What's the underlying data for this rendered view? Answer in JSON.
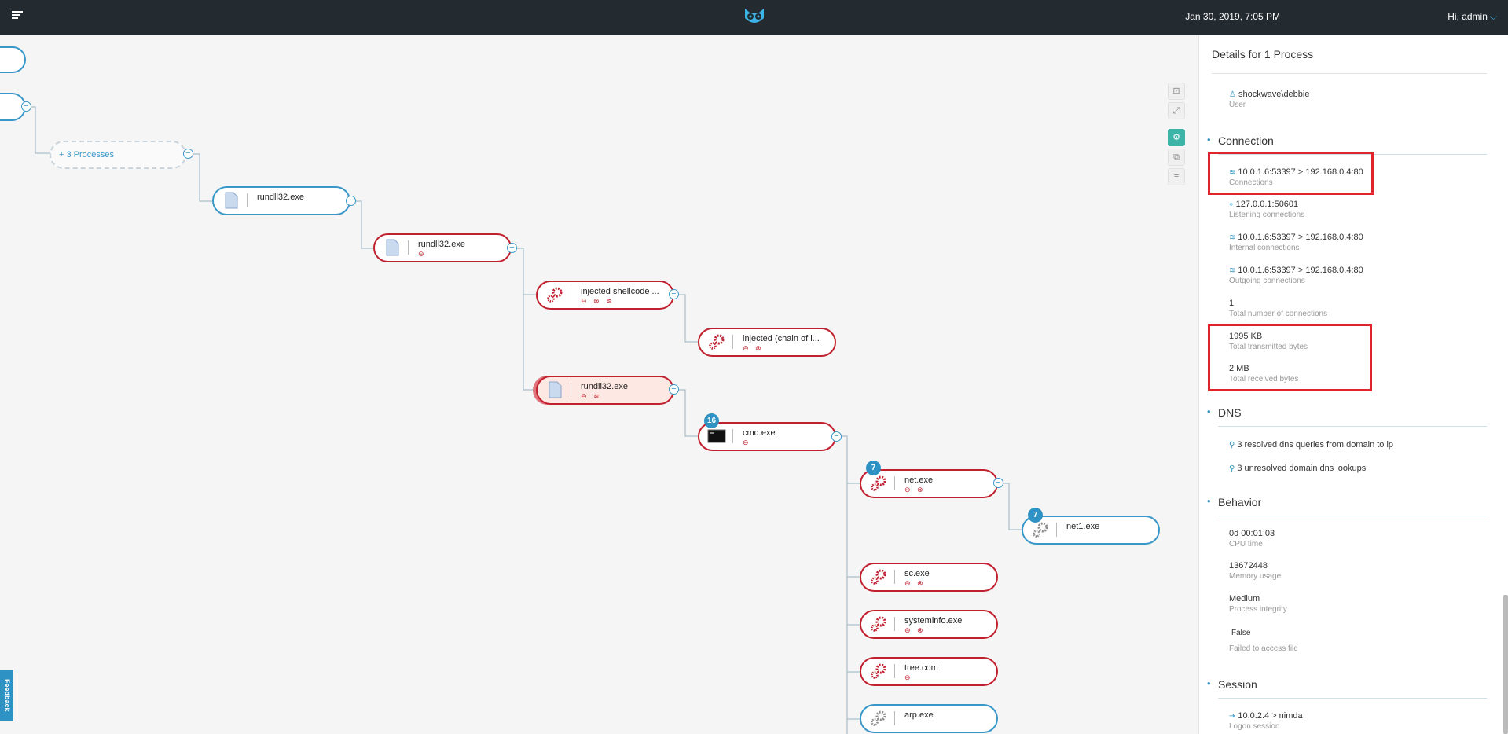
{
  "header": {
    "datetime": "Jan 30, 2019, 7:05 PM",
    "user_greeting": "Hi, admin",
    "chevron": "⌵"
  },
  "tree": {
    "group_label": "+ 3 Processes",
    "collapse_glyph": "−",
    "nodes": {
      "n1": {
        "label": "rundll32.exe",
        "badges": ""
      },
      "n2": {
        "label": "rundll32.exe",
        "badges": "⊖"
      },
      "n3": {
        "label": "injected shellcode ...",
        "badges": "⊖ ⊗ ≋"
      },
      "n4": {
        "label": "injected (chain of i...",
        "badges": "⊖ ⊗"
      },
      "n5": {
        "label": "rundll32.exe",
        "badges": "⊖ ≋"
      },
      "n6": {
        "label": "cmd.exe",
        "badges": "⊖",
        "count": "16"
      },
      "n7": {
        "label": "net.exe",
        "badges": "⊖ ⊗",
        "count": "7"
      },
      "n8": {
        "label": "net1.exe",
        "badges": "",
        "count": "7"
      },
      "n9": {
        "label": "sc.exe",
        "badges": "⊖ ⊗"
      },
      "n10": {
        "label": "systeminfo.exe",
        "badges": "⊖ ⊗"
      },
      "n11": {
        "label": "tree.com",
        "badges": "⊖"
      },
      "n12": {
        "label": "arp.exe",
        "badges": ""
      }
    }
  },
  "feedback_label": "Feedback",
  "details": {
    "title": "Details for 1 Process",
    "user": {
      "value": "shockwave\\debbie",
      "label": "User"
    },
    "connection": {
      "heading": "Connection",
      "items": [
        {
          "value": "10.0.1.6:53397 > 192.168.0.4:80",
          "label": "Connections"
        },
        {
          "value": "127.0.0.1:50601",
          "label": "Listening connections"
        },
        {
          "value": "10.0.1.6:53397 > 192.168.0.4:80",
          "label": "Internal connections"
        },
        {
          "value": "10.0.1.6:53397 > 192.168.0.4:80",
          "label": "Outgoing connections"
        },
        {
          "value": "1",
          "label": "Total number of connections"
        },
        {
          "value": "1995 KB",
          "label": "Total transmitted bytes"
        },
        {
          "value": "2 MB",
          "label": "Total received bytes"
        }
      ]
    },
    "dns": {
      "heading": "DNS",
      "items": [
        {
          "value": "3 resolved dns queries from domain to ip"
        },
        {
          "value": "3 unresolved domain dns lookups"
        }
      ]
    },
    "behavior": {
      "heading": "Behavior",
      "items": [
        {
          "value": "0d 00:01:03",
          "label": "CPU time"
        },
        {
          "value": "13672448",
          "label": "Memory usage"
        },
        {
          "value": "Medium",
          "label": "Process integrity"
        },
        {
          "value": "False",
          "label": "Failed to access file"
        }
      ]
    },
    "session": {
      "heading": "Session",
      "items": [
        {
          "value": "10.0.2.4 > nimda",
          "label": "Logon session"
        }
      ]
    }
  }
}
